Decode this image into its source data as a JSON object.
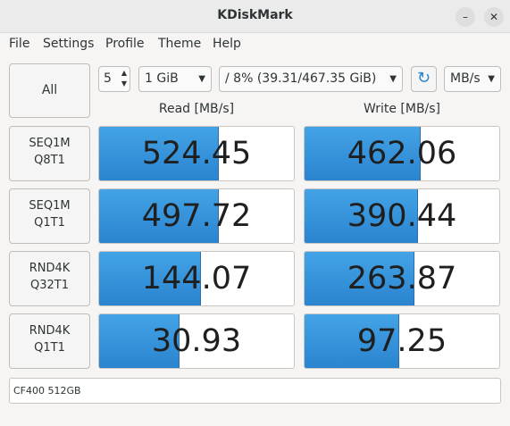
{
  "window": {
    "title": "KDiskMark",
    "minimize_icon": "minimize-icon",
    "close_icon": "close-icon"
  },
  "menu": [
    "File",
    "Settings",
    "Profile",
    "Theme",
    "Help"
  ],
  "toolbar": {
    "all_label": "All",
    "loops_value": "5",
    "size_value": "1 GiB",
    "path_value": "/ 8% (39.31/467.35 GiB)",
    "refresh_icon": "refresh-icon",
    "unit_value": "MB/s"
  },
  "headers": {
    "read": "Read [MB/s]",
    "write": "Write [MB/s]"
  },
  "tests": [
    {
      "line1": "SEQ1M",
      "line2": "Q8T1",
      "read": "524.45",
      "read_fill": 0.61,
      "write": "462.06",
      "write_fill": 0.59
    },
    {
      "line1": "SEQ1M",
      "line2": "Q1T1",
      "read": "497.72",
      "read_fill": 0.61,
      "write": "390.44",
      "write_fill": 0.58
    },
    {
      "line1": "RND4K",
      "line2": "Q32T1",
      "read": "144.07",
      "read_fill": 0.52,
      "write": "263.87",
      "write_fill": 0.56
    },
    {
      "line1": "RND4K",
      "line2": "Q1T1",
      "read": "30.93",
      "read_fill": 0.41,
      "write": "97.25",
      "write_fill": 0.48
    }
  ],
  "device": "CF400 512GB",
  "colors": {
    "bar": "#2f8fdd",
    "window_bg": "#f6f5f4"
  }
}
